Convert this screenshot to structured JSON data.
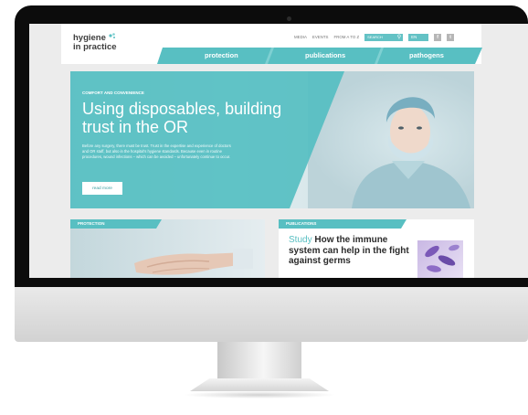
{
  "site": {
    "logo_line1": "hygiene",
    "logo_line2": "in practice"
  },
  "utility_nav": {
    "items": [
      "MEDIA",
      "EVENTS",
      "FROM A TO Z"
    ],
    "search_label": "SEARCH",
    "language": "EN",
    "social": [
      "f",
      "t"
    ]
  },
  "main_nav": [
    "protection",
    "publications",
    "pathogens"
  ],
  "hero": {
    "kicker": "COMFORT AND CONVENIENCE",
    "title": "Using disposables, building trust in the OR",
    "text": "Before any surgery, there must be trust. Trust in the expertise and experience of doctors and OR staff, but also in the hospital's hygiene standards. Because even in routine procedures, wound infections – which can be avoided – unfortunately continue to occur.",
    "button": "read more"
  },
  "panels": {
    "left_label": "PROTECTION",
    "right_label": "PUBLICATIONS",
    "right_tag": "Study",
    "right_title": "How the immune system can help in the fight against germs"
  },
  "colors": {
    "accent": "#58bfc2",
    "bezel": "#0c0c0c"
  }
}
